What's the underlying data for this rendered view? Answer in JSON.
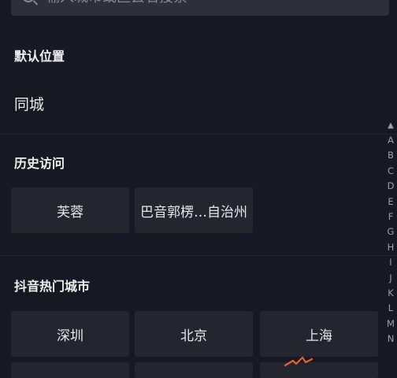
{
  "search": {
    "placeholder": "输入城市或区县名搜索"
  },
  "sections": {
    "default_location_title": "默认位置",
    "default_location_city": "同城",
    "history_title": "历史访问",
    "hot_title": "抖音热门城市"
  },
  "history": [
    "芙蓉",
    "巴音郭楞…自治州"
  ],
  "hot_cities": [
    "深圳",
    "北京",
    "上海"
  ],
  "index": {
    "arrow": "▲",
    "letters": [
      "A",
      "B",
      "C",
      "D",
      "E",
      "F",
      "G",
      "H",
      "I",
      "J",
      "K",
      "L",
      "M",
      "N"
    ]
  },
  "colors": {
    "background": "#161823",
    "chip": "#24262f",
    "search_bg": "#2d2f3a",
    "accent_orange": "#e8622a"
  }
}
